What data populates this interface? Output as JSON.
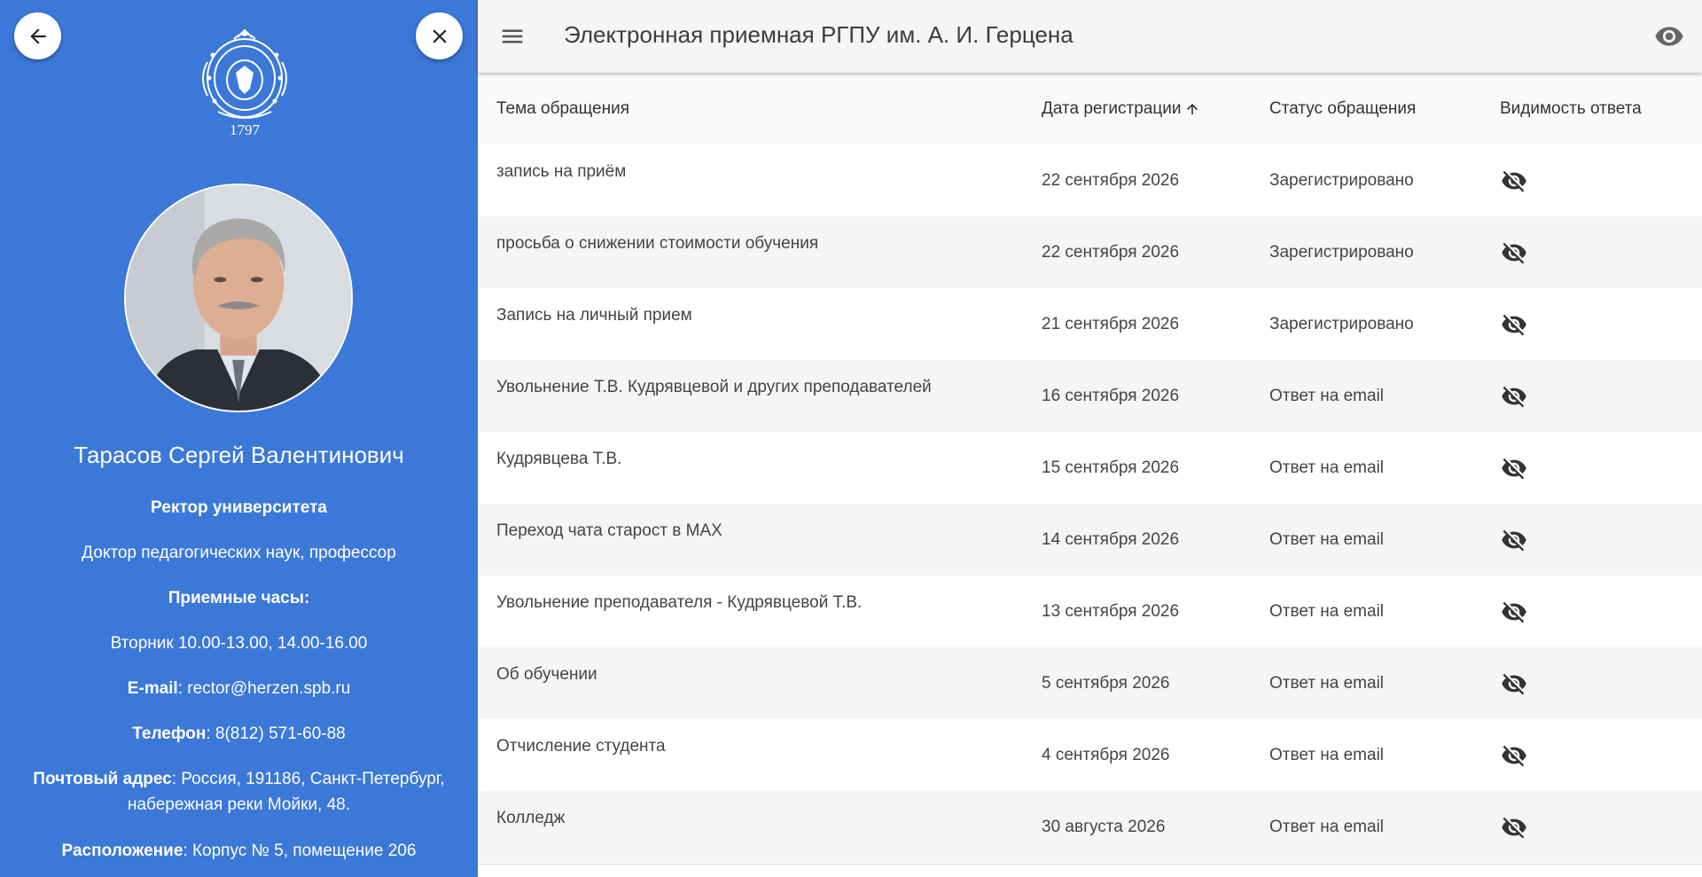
{
  "profile": {
    "logo_year": "1797",
    "name": "Тарасов Сергей Валентинович",
    "position": "Ректор университета",
    "degree": "Доктор педагогических наук, профессор",
    "hours_label": "Приемные часы:",
    "hours_value": "Вторник 10.00-13.00, 14.00-16.00",
    "email_label": "E-mail",
    "email_value": ": rector@herzen.spb.ru",
    "phone_label": "Телефон",
    "phone_value": ": 8(812) 571-60-88",
    "address_label": "Почтовый адрес",
    "address_value": ": Россия, 191186, Санкт-Петербург, набережная реки Мойки, 48.",
    "location_label": "Расположение",
    "location_value": ": Корпус № 5, помещение 206"
  },
  "header": {
    "title": "Электронная приемная РГПУ им. А. И. Герцена"
  },
  "table": {
    "columns": [
      "Тема обращения",
      "Дата регистрации",
      "Статус обращения",
      "Видимость ответа"
    ],
    "rows": [
      {
        "topic": "запись на приём",
        "date": "22 сентября 2026",
        "status": "Зарегистрировано"
      },
      {
        "topic": "просьба о снижении стоимости обучения",
        "date": "22 сентября 2026",
        "status": "Зарегистрировано"
      },
      {
        "topic": "Запись на личный прием",
        "date": "21 сентября 2026",
        "status": "Зарегистрировано"
      },
      {
        "topic": "Увольнение Т.В. Кудрявцевой и других преподавателей",
        "date": "16 сентября 2026",
        "status": "Ответ на email"
      },
      {
        "topic": "Кудрявцева Т.В.",
        "date": "15 сентября 2026",
        "status": "Ответ на email"
      },
      {
        "topic": "Переход чата старост в МАХ",
        "date": "14 сентября 2026",
        "status": "Ответ на email"
      },
      {
        "topic": "Увольнение преподавателя - Кудрявцевой Т.В.",
        "date": "13 сентября 2026",
        "status": "Ответ на email"
      },
      {
        "topic": "Об обучении",
        "date": "5 сентября 2026",
        "status": "Ответ на email"
      },
      {
        "topic": "Отчисление студента",
        "date": "4 сентября 2026",
        "status": "Ответ на email"
      },
      {
        "topic": "Колледж",
        "date": "30 августа 2026",
        "status": "Ответ на email"
      }
    ]
  },
  "icons": {
    "back": "arrow-left-icon",
    "close": "close-icon",
    "menu": "menu-icon",
    "visibility": "eye-icon",
    "row_visibility": "eye-off-icon",
    "sort": "arrow-up-icon"
  },
  "colors": {
    "side_panel": "#3b78d8",
    "topbar": "#f5f5f5"
  }
}
